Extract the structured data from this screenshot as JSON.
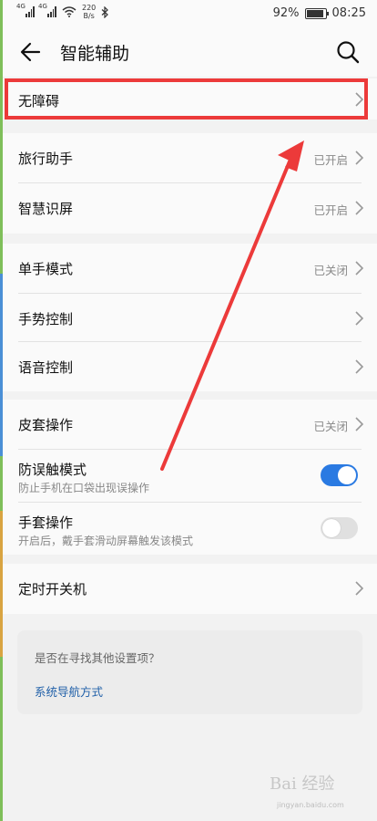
{
  "status_bar": {
    "sig1": "4G",
    "sig2": "4G",
    "speed_value": "220",
    "speed_unit": "B/s",
    "battery": "92%",
    "battery_level": 0.92,
    "time": "08:25"
  },
  "header": {
    "title": "智能辅助"
  },
  "groups": {
    "g1": {
      "accessibility": "无障碍"
    },
    "g2": {
      "travel": {
        "label": "旅行助手",
        "status": "已开启"
      },
      "smart_screen": {
        "label": "智慧识屏",
        "status": "已开启"
      }
    },
    "g3": {
      "one_hand": {
        "label": "单手模式",
        "status": "已关闭"
      },
      "gesture": {
        "label": "手势控制"
      },
      "voice": {
        "label": "语音控制"
      }
    },
    "g4": {
      "cover": {
        "label": "皮套操作",
        "status": "已关闭"
      },
      "mistouch": {
        "label": "防误触模式",
        "sub": "防止手机在口袋出现误操作",
        "enabled": true
      },
      "glove": {
        "label": "手套操作",
        "sub": "开启后，戴手套滑动屏幕触发该模式",
        "enabled": false
      }
    },
    "g5": {
      "timer_power": {
        "label": "定时开关机"
      }
    }
  },
  "suggestion": {
    "question": "是否在寻找其他设置项？",
    "link": "系统导航方式"
  },
  "colors": {
    "accent": "#2a7ae2",
    "annotation": "#ec3a3a"
  },
  "watermark": {
    "brand": "Bai 经验",
    "site": "jingyan.baidu.com"
  }
}
